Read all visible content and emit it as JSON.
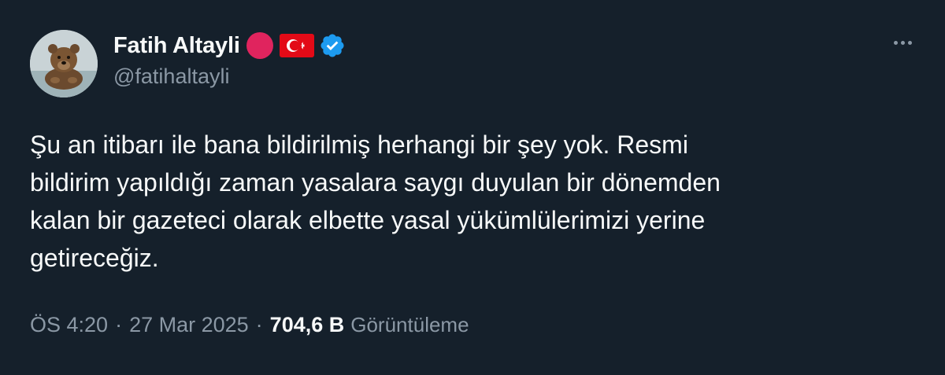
{
  "author": {
    "display_name": "Fatih Altayli",
    "handle": "@fatihaltayli",
    "avatar_icon": "bear-photo-avatar",
    "badges": [
      "red-circle-icon",
      "turkey-flag-icon",
      "verified-badge-icon"
    ]
  },
  "tweet": {
    "text": "Şu an itibarı ile bana bildirilmiş herhangi bir şey yok. Resmi\nbildirim yapıldığı zaman yasalara saygı duyulan bir dönemden\nkalan bir gazeteci olarak elbette yasal yükümlülerimizi yerine\ngetireceğiz.",
    "time": "ÖS 4:20",
    "date": "27 Mar 2025",
    "separator": "·",
    "views_count": "704,6 B",
    "views_label": "Görüntüleme"
  },
  "colors": {
    "background": "#15202b",
    "text_primary": "#f7f9f9",
    "text_secondary": "#8b98a5",
    "verified_blue": "#1d9bf0",
    "red_dot": "#e0245e",
    "flag_red": "#e30a17"
  },
  "menu": {
    "more_icon": "more-horizontal-icon"
  }
}
